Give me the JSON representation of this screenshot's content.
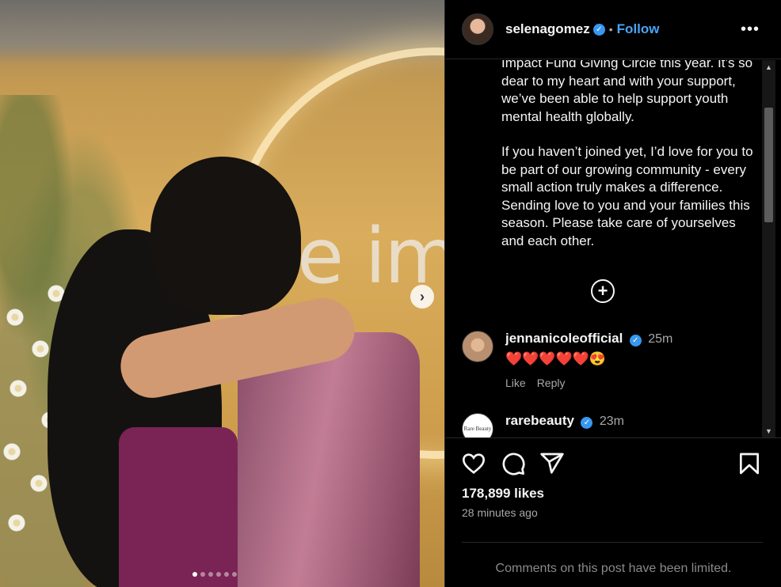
{
  "post": {
    "username": "selenagomez",
    "separator": "•",
    "follow_label": "Follow",
    "more_label": "•••",
    "photo_wall_text": "e imp",
    "carousel": {
      "count": 6,
      "active": 0
    }
  },
  "caption": {
    "paragraph1": "Impact Fund Giving Circle this year. It’s so dear to my heart and with your support, we’ve been able to help support youth mental health globally.",
    "paragraph2": "If you haven’t joined yet, I’d love for you to be part of our growing community - every small action truly makes a difference. Sending love to you and your families this season. Please take care of yourselves and each other."
  },
  "load_more_icon": "plus-circle-icon",
  "comments": [
    {
      "username": "jennanicoleofficial",
      "time": "25m",
      "text": "❤️❤️❤️❤️❤️😍",
      "like_label": "Like",
      "reply_label": "Reply",
      "avatar_color": "#c9a58a"
    },
    {
      "username": "rarebeauty",
      "time": "23m",
      "text": "",
      "avatar_text": "Rare Beauty",
      "avatar_color": "#ffffff"
    }
  ],
  "footer": {
    "likes": "178,899 likes",
    "timestamp": "28 minutes ago",
    "limited_notice": "Comments on this post have been limited."
  },
  "colors": {
    "background": "#000000",
    "link_blue": "#4aa3f5",
    "verified_blue": "#3897f0",
    "secondary_text": "#a8a8a8"
  }
}
